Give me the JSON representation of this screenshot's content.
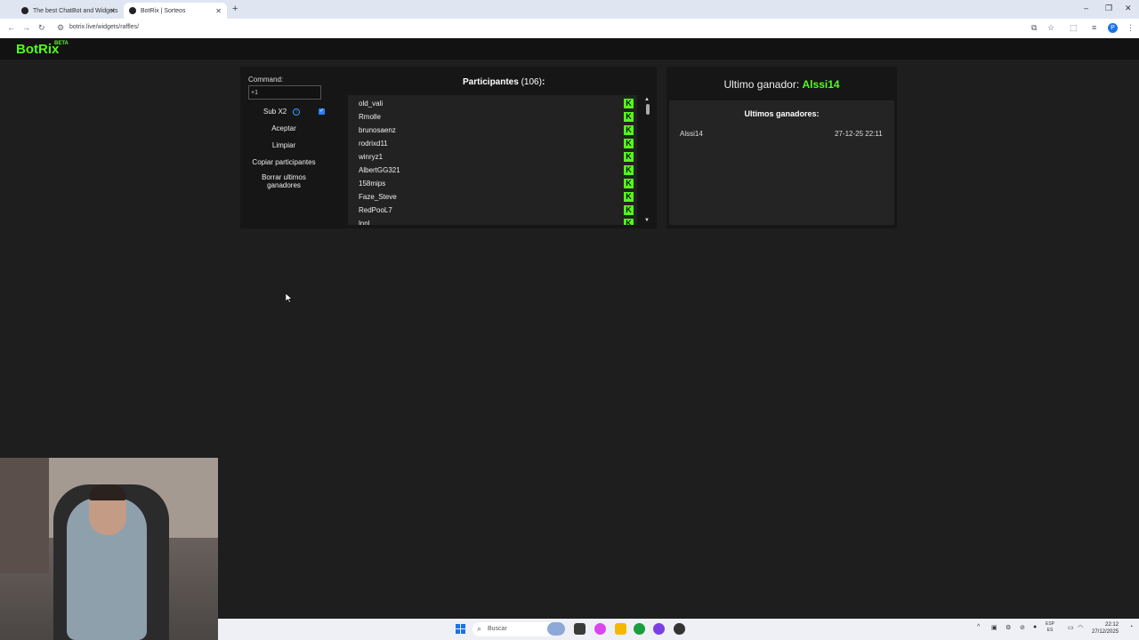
{
  "browser": {
    "tabs": [
      {
        "title": "The best ChatBot and Widgets"
      },
      {
        "title": "BotRix | Sorteos"
      }
    ],
    "new_tab": "+",
    "url": "botrix.live/widgets/raffles/",
    "profile_initial": "P",
    "window_controls": [
      "–",
      "❐",
      "✕"
    ]
  },
  "site": {
    "logo": "BotRix",
    "beta": "BETA"
  },
  "controls": {
    "command_label": "Command:",
    "command_value": "+1",
    "sub_label": "Sub X2",
    "sub_checked": true,
    "accept": "Aceptar",
    "clear": "Limpiar",
    "copy": "Copiar participantes",
    "delete_last_1": "Borrar ultimos",
    "delete_last_2": "ganadores"
  },
  "participants": {
    "title": "Participantes",
    "count": "(106)",
    "colon": ":",
    "platform_icon": "K",
    "items": [
      "old_vali",
      "Rmolle",
      "brunosaenz",
      "rodrixd11",
      "winryz1",
      "AlbertGG321",
      "158mips",
      "Faze_Steve",
      "RedPooL7",
      "lnnl"
    ]
  },
  "winner": {
    "label": "Ultimo ganador:",
    "name": "Alssi14",
    "list_title": "Ultimos ganadores:",
    "entries": [
      {
        "name": "Alssi14",
        "date": "27-12-25 22:11"
      }
    ]
  },
  "taskbar": {
    "search_placeholder": "Buscar",
    "lang_1": "ESP",
    "lang_2": "ES",
    "time": "22:12",
    "date": "27/12/2025"
  },
  "colors": {
    "accent": "#53fc18",
    "background": "#1e1e1e",
    "panel": "#161616"
  }
}
